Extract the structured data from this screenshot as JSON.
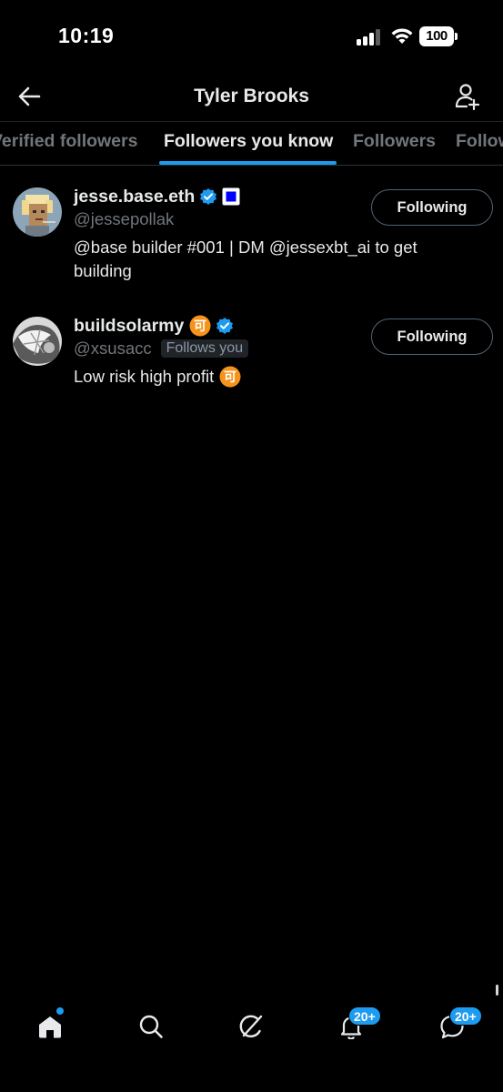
{
  "status_bar": {
    "time": "10:19",
    "battery": "100"
  },
  "header": {
    "title": "Tyler Brooks"
  },
  "tabs": [
    {
      "label": "Verified followers",
      "active": false
    },
    {
      "label": "Followers you know",
      "active": true
    },
    {
      "label": "Followers",
      "active": false
    },
    {
      "label": "Following",
      "active": false
    }
  ],
  "users": [
    {
      "display_name": "jesse.base.eth",
      "handle": "@jessepollak",
      "follows_you": "",
      "bio": "@base builder #001 | DM @jessexbt_ai to get building",
      "button": "Following",
      "verified": true
    },
    {
      "display_name": "buildsolarmy",
      "handle": "@xsusacc",
      "follows_you": "Follows you",
      "bio": "Low risk high profit",
      "emoji_badge": "可",
      "button": "Following",
      "verified": true
    }
  ],
  "bottom_nav": {
    "items": [
      "home-icon",
      "search-icon",
      "grok-icon",
      "bell-icon",
      "messages-icon"
    ],
    "notifications_count": "20+",
    "messages_count": "20+"
  },
  "colors": {
    "accent": "#1d9bf0",
    "background": "#000000",
    "muted": "#71767b",
    "emoji_orange": "#f7931a"
  }
}
